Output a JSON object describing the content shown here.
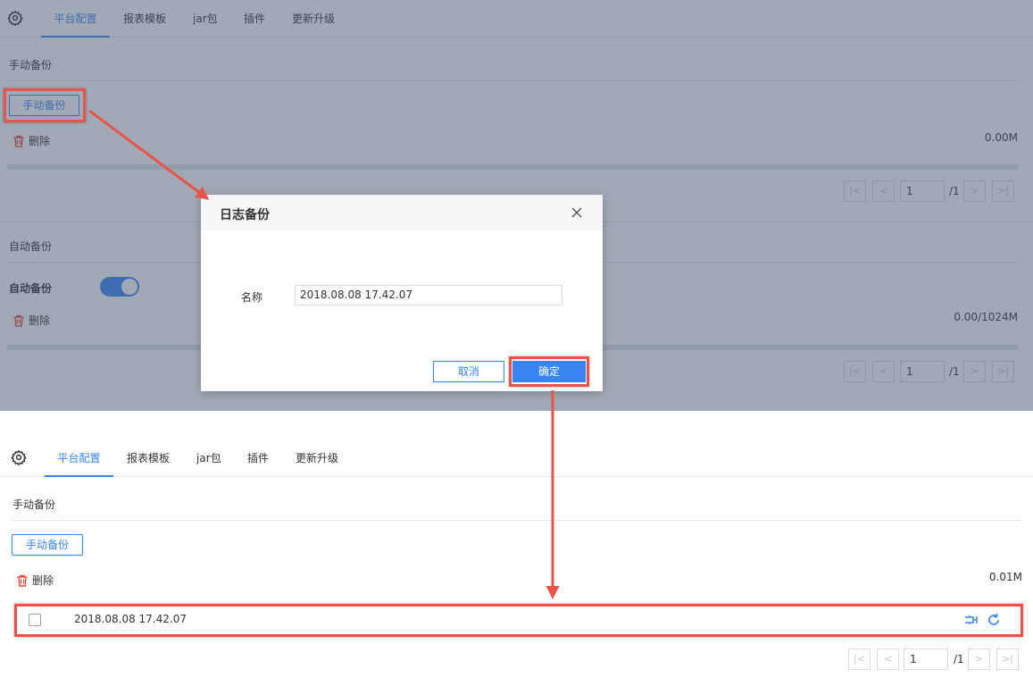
{
  "tabs": [
    "平台配置",
    "报表模板",
    "jar包",
    "插件",
    "更新升级"
  ],
  "before": {
    "manual": {
      "section_title": "手动备份",
      "button_label": "手动备份",
      "delete_label": "删除",
      "size": "0.00M"
    },
    "auto": {
      "section_title": "自动备份",
      "toggle_label": "自动备份",
      "toggle_on": true,
      "delete_label": "删除",
      "size": "0.00/1024M"
    },
    "pager": {
      "page": "1",
      "total": "/1"
    }
  },
  "dialog": {
    "title": "日志备份",
    "name_label": "名称",
    "name_value": "2018.08.08 17.42.07",
    "cancel_label": "取消",
    "ok_label": "确定"
  },
  "after": {
    "section_title": "手动备份",
    "button_label": "手动备份",
    "delete_label": "删除",
    "size": "0.01M",
    "rows": [
      {
        "name": "2018.08.08 17.42.07"
      }
    ],
    "pager": {
      "page": "1",
      "total": "/1"
    }
  },
  "colors": {
    "accent": "#3685f2",
    "highlight": "#e8544a",
    "delete_icon": "#e05045"
  }
}
